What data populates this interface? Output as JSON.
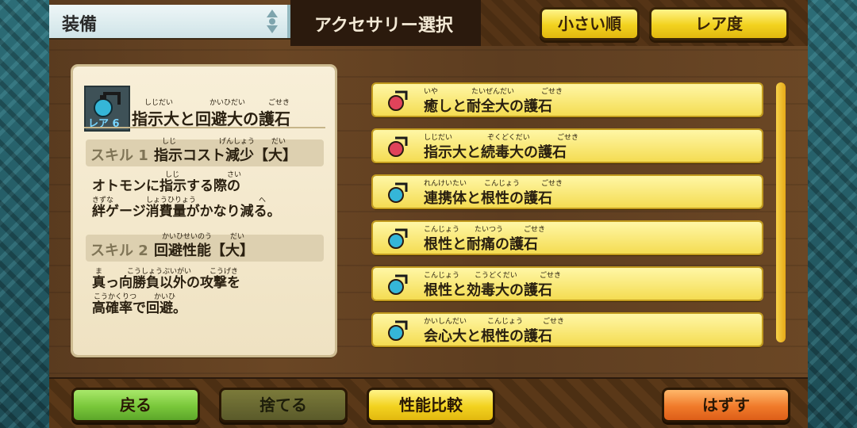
{
  "header": {
    "title": "装備",
    "section": "アクセサリー選択",
    "sort_size": "小さい順",
    "sort_rarity": "レア度"
  },
  "detail": {
    "rarity": "レア 6",
    "name": "指示大と回避大の護石",
    "name_ruby": [
      "しじだい",
      "かいひだい",
      "ごせき"
    ],
    "skill1": {
      "label": "スキル 1",
      "name": "指示コスト減少【大】",
      "ruby": [
        "しじ",
        "げんしょう",
        "だい"
      ],
      "desc_line1": "オトモンに指示する際の",
      "desc_line2": "絆ゲージ消費量がかなり減る。",
      "desc_ruby": [
        "しじ",
        "さい",
        "きずな",
        "しょうひりょう",
        "へ"
      ]
    },
    "skill2": {
      "label": "スキル 2",
      "name": "回避性能【大】",
      "ruby": [
        "かいひせいのう",
        "だい"
      ],
      "desc_line1": "真っ向勝負以外の攻撃を",
      "desc_line2": "高確率で回避。",
      "desc_ruby": [
        "ま",
        "こうしょうぶいがい",
        "こうげき",
        "こうかくりつ",
        "かいひ"
      ]
    }
  },
  "list": [
    {
      "name": "癒しと耐全大の護石",
      "ruby": [
        "いや",
        "たいぜんだい",
        "ごせき"
      ],
      "color": "#e0435a"
    },
    {
      "name": "指示大と続毒大の護石",
      "ruby": [
        "しじだい",
        "ぞくどくだい",
        "ごせき"
      ],
      "color": "#e0435a"
    },
    {
      "name": "連携体と根性の護石",
      "ruby": [
        "れんけいたい",
        "こんじょう",
        "ごせき"
      ],
      "color": "#35b6d8"
    },
    {
      "name": "根性と耐痛の護石",
      "ruby": [
        "こんじょう",
        "たいつう",
        "ごせき"
      ],
      "color": "#35b6d8"
    },
    {
      "name": "根性と効毒大の護石",
      "ruby": [
        "こんじょう",
        "こうどくだい",
        "ごせき"
      ],
      "color": "#35b6d8"
    },
    {
      "name": "会心大と根性の護石",
      "ruby": [
        "かいしんだい",
        "こんじょう",
        "ごせき"
      ],
      "color": "#35b6d8"
    }
  ],
  "footer": {
    "back": "戻る",
    "discard": "捨てる",
    "compare": "性能比較",
    "remove": "はずす"
  },
  "colors": {
    "green_button": "#79c73a",
    "dark_button": "#5a5a2a",
    "yellow_button": "#f2d21f",
    "orange_button": "#f07a2a"
  }
}
